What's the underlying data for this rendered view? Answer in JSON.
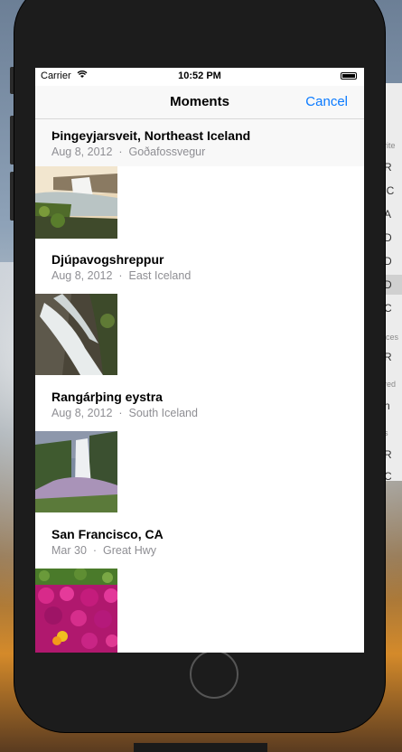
{
  "status": {
    "carrier": "Carrier",
    "time": "10:52 PM"
  },
  "nav": {
    "title": "Moments",
    "cancel_label": "Cancel"
  },
  "sections": [
    {
      "place": "Þingeyjarsveit, Northeast Iceland",
      "date": "Aug 8, 2012",
      "location": "Goðafossvegur",
      "photo": "waterfall-godafoss"
    },
    {
      "place": "Djúpavogshreppur",
      "date": "Aug 8, 2012",
      "location": "East Iceland",
      "photo": "waterfall-rocks"
    },
    {
      "place": "Rangárþing eystra",
      "date": "Aug 8, 2012",
      "location": "South Iceland",
      "photo": "waterfall-skogafoss"
    },
    {
      "place": "San Francisco, CA",
      "date": "Mar 30",
      "location": "Great Hwy",
      "photo": "pink-flowers"
    }
  ],
  "separator": "·",
  "finder_sidebar": {
    "section_labels": [
      "rite",
      "ices",
      "red",
      "s"
    ],
    "items": [
      "R",
      "iC",
      "A",
      "D",
      "D",
      "D",
      "C",
      "R",
      "n",
      "R",
      "C"
    ]
  }
}
